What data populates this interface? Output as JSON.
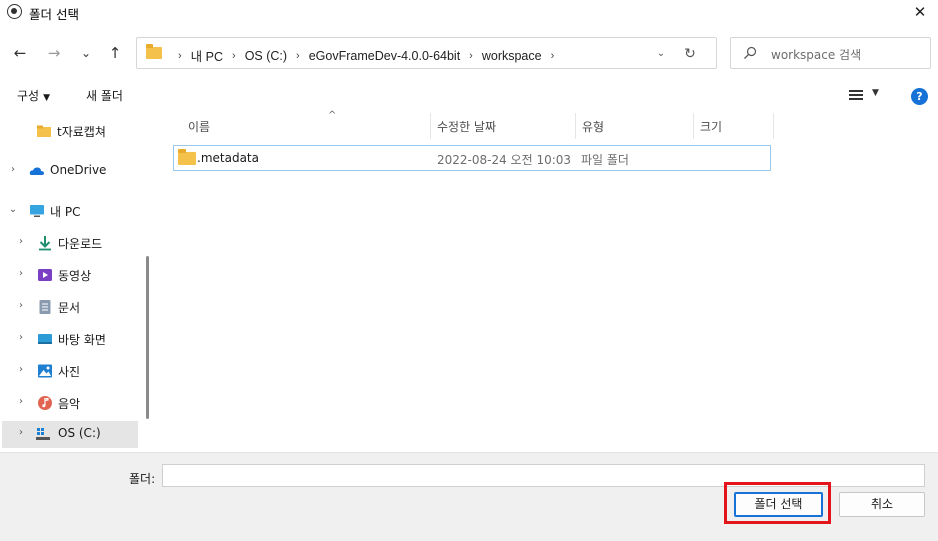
{
  "window": {
    "title": "폴더 선택"
  },
  "nav": {
    "back": "←",
    "forward": "→",
    "recent": "⌄",
    "up": "↑"
  },
  "address": {
    "crumbs": [
      "내 PC",
      "OS (C:)",
      "eGovFrameDev-4.0.0-64bit",
      "workspace"
    ]
  },
  "search": {
    "placeholder": "workspace 검색"
  },
  "toolbar": {
    "organize_label": "구성",
    "new_folder_label": "새 폴더"
  },
  "sidebar": {
    "items": [
      {
        "label": "t자료캡쳐",
        "icon": "folder-icon"
      },
      {
        "label": "OneDrive",
        "icon": "cloud-icon"
      },
      {
        "label": "내 PC",
        "icon": "pc-icon"
      },
      {
        "label": "다운로드",
        "icon": "download-icon"
      },
      {
        "label": "동영상",
        "icon": "video-icon"
      },
      {
        "label": "문서",
        "icon": "document-icon"
      },
      {
        "label": "바탕 화면",
        "icon": "desktop-icon"
      },
      {
        "label": "사진",
        "icon": "picture-icon"
      },
      {
        "label": "음악",
        "icon": "music-icon"
      },
      {
        "label": "OS (C:)",
        "icon": "drive-icon"
      }
    ]
  },
  "columns": {
    "name": "이름",
    "modified": "수정한 날짜",
    "type": "유형",
    "size": "크기"
  },
  "files": [
    {
      "name": ".metadata",
      "modified": "2022-08-24 오전 10:03",
      "type": "파일 폴더",
      "size": ""
    }
  ],
  "bottom": {
    "folder_label": "폴더:",
    "folder_value": "",
    "select_button": "폴더 선택",
    "cancel_button": "취소"
  },
  "colors": {
    "accent": "#1672d6",
    "highlight": "#e3151a",
    "selection": "#99c9ef"
  }
}
